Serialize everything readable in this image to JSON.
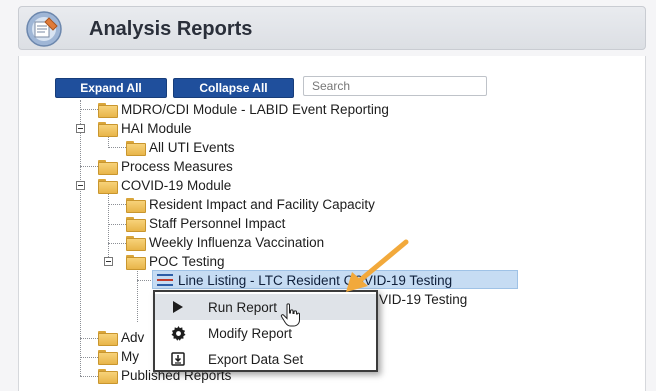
{
  "header": {
    "title": "Analysis Reports",
    "logo_icon": "analysis-reports-logo-icon"
  },
  "toolbar": {
    "expand_all": "Expand All",
    "collapse_all": "Collapse All",
    "search_placeholder": "Search"
  },
  "tree": {
    "mdro": "MDRO/CDI Module - LABID Event Reporting",
    "hai": "HAI Module",
    "all_uti": "All UTI Events",
    "process": "Process Measures",
    "covid": "COVID-19 Module",
    "resident_impact": "Resident Impact and Facility Capacity",
    "staff": "Staff Personnel Impact",
    "influenza": "Weekly Influenza Vaccination",
    "poc": "POC Testing",
    "line_listing": "Line Listing - LTC Resident COVID-19 Testing",
    "second_report_tail": "VID-19 Testing",
    "adv_partial": "Adv",
    "my_partial": "My",
    "published": "Published Reports"
  },
  "context_menu": {
    "run": "Run Report",
    "modify": "Modify Report",
    "export": "Export Data Set"
  },
  "colors": {
    "button_blue": "#1f4f9c",
    "highlight": "#c6dcf3",
    "annotation_arrow": "#f2a93b"
  }
}
